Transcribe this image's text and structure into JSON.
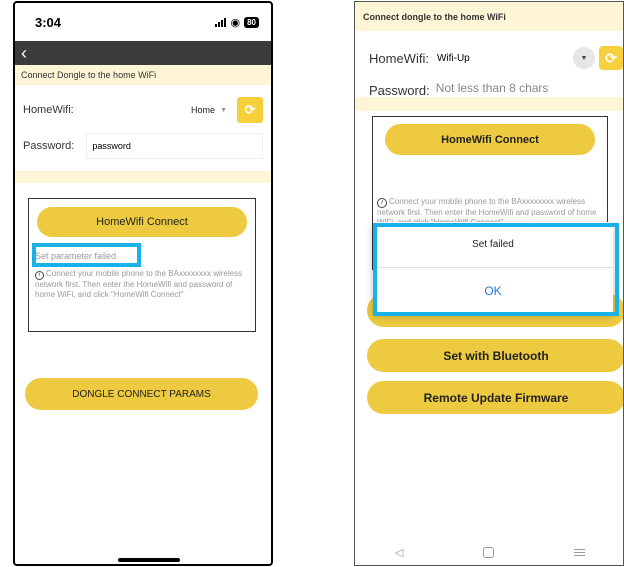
{
  "left": {
    "status": {
      "time": "3:04",
      "battery": "80"
    },
    "back_icon": "chevron-left-icon",
    "header_title": "Connect Dongle to the home WiFi",
    "wifi": {
      "label": "HomeWifi:",
      "value": "Home"
    },
    "password": {
      "label": "Password:",
      "value": "password"
    },
    "connect_button": "HomeWifi Connect",
    "error_text": "Set parameter failed",
    "info_text": "Connect your mobile phone to the BAxxxxxxxx wireless network first. Then enter the HomeWifi and password of home WiFi, and click \"HomeWifi Connect\"",
    "dongle_button": "DONGLE CONNECT PARAMS",
    "highlight_color": "#1ab0e8",
    "accent_color": "#edca40"
  },
  "right": {
    "header_title": "Connect dongle to the home WiFi",
    "wifi": {
      "label": "HomeWifi:",
      "value": "Wifi-Up"
    },
    "password": {
      "label": "Password:",
      "placeholder": "Not less than 8 chars"
    },
    "connect_button": "HomeWifi Connect",
    "info_text": "Connect your mobile phone to the BAxxxxxxxx wireless network first. Then enter the HomeWifi and password of home WiFi, and click \"HomeWifi Connect\"",
    "dialog": {
      "message": "Set failed",
      "ok": "OK"
    },
    "bluetooth_button": "Set with Bluetooth",
    "firmware_button": "Remote Update Firmware"
  }
}
